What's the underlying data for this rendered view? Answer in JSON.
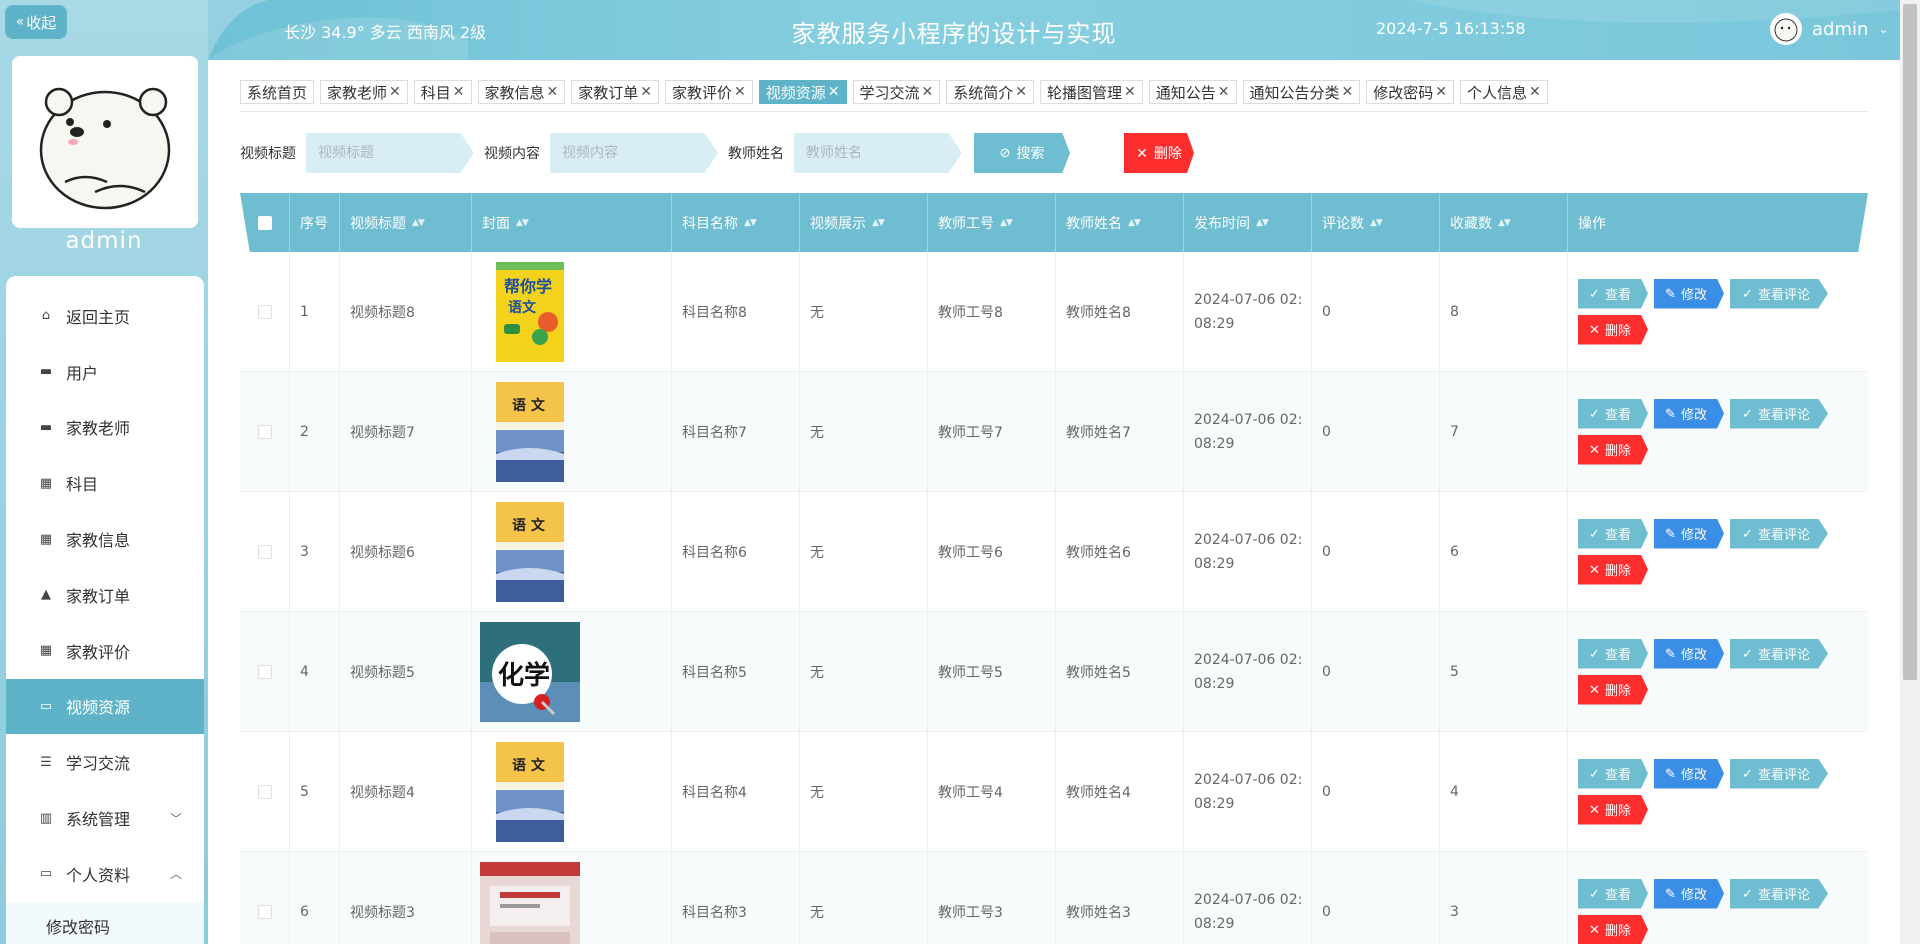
{
  "sidebar": {
    "collapse_label": "收起",
    "username": "admin",
    "menu": [
      {
        "label": "返回主页",
        "icon": "home-icon"
      },
      {
        "label": "用户",
        "icon": "user-icon"
      },
      {
        "label": "家教老师",
        "icon": "teacher-icon"
      },
      {
        "label": "科目",
        "icon": "grid-icon"
      },
      {
        "label": "家教信息",
        "icon": "grid-icon"
      },
      {
        "label": "家教订单",
        "icon": "person-icon"
      },
      {
        "label": "家教评价",
        "icon": "grid-icon"
      },
      {
        "label": "视频资源",
        "icon": "monitor-icon",
        "active": true
      },
      {
        "label": "学习交流",
        "icon": "list-icon"
      },
      {
        "label": "系统管理",
        "icon": "chart-icon",
        "chevron": "down"
      },
      {
        "label": "个人资料",
        "icon": "card-icon",
        "chevron": "up"
      }
    ],
    "submenu": [
      {
        "label": "修改密码"
      }
    ]
  },
  "header": {
    "weather": "长沙  34.9°  多云  西南风  2级",
    "title": "家教服务小程序的设计与实现",
    "datetime": "2024-7-5 16:13:58",
    "username": "admin"
  },
  "tabs": [
    {
      "label": "系统首页",
      "closable": false
    },
    {
      "label": "家教老师",
      "closable": true
    },
    {
      "label": "科目",
      "closable": true
    },
    {
      "label": "家教信息",
      "closable": true
    },
    {
      "label": "家教订单",
      "closable": true
    },
    {
      "label": "家教评价",
      "closable": true
    },
    {
      "label": "视频资源",
      "closable": true,
      "active": true
    },
    {
      "label": "学习交流",
      "closable": true
    },
    {
      "label": "系统简介",
      "closable": true
    },
    {
      "label": "轮播图管理",
      "closable": true
    },
    {
      "label": "通知公告",
      "closable": true
    },
    {
      "label": "通知公告分类",
      "closable": true
    },
    {
      "label": "修改密码",
      "closable": true
    },
    {
      "label": "个人信息",
      "closable": true
    }
  ],
  "search": {
    "title_label": "视频标题",
    "title_placeholder": "视频标题",
    "content_label": "视频内容",
    "content_placeholder": "视频内容",
    "teacher_label": "教师姓名",
    "teacher_placeholder": "教师姓名",
    "search_button": "搜索",
    "delete_button": "删除"
  },
  "table": {
    "columns": [
      "",
      "序号",
      "视频标题",
      "封面",
      "科目名称",
      "视频展示",
      "教师工号",
      "教师姓名",
      "发布时间",
      "评论数",
      "收藏数",
      "操作"
    ],
    "actions": {
      "view": "查看",
      "edit": "修改",
      "comment": "查看评论",
      "delete": "删除"
    },
    "rows": [
      {
        "index": "1",
        "title": "视频标题8",
        "cover": "yellow-book",
        "subject": "科目名称8",
        "show": "无",
        "tno": "教师工号8",
        "tname": "教师姓名8",
        "time": "2024-07-06 02:\n08:29",
        "comments": "0",
        "favorites": "8"
      },
      {
        "index": "2",
        "title": "视频标题7",
        "cover": "yuwen-book",
        "subject": "科目名称7",
        "show": "无",
        "tno": "教师工号7",
        "tname": "教师姓名7",
        "time": "2024-07-06 02:\n08:29",
        "comments": "0",
        "favorites": "7"
      },
      {
        "index": "3",
        "title": "视频标题6",
        "cover": "yuwen-book",
        "subject": "科目名称6",
        "show": "无",
        "tno": "教师工号6",
        "tname": "教师姓名6",
        "time": "2024-07-06 02:\n08:29",
        "comments": "0",
        "favorites": "6"
      },
      {
        "index": "4",
        "title": "视频标题5",
        "cover": "chemistry-book",
        "subject": "科目名称5",
        "show": "无",
        "tno": "教师工号5",
        "tname": "教师姓名5",
        "time": "2024-07-06 02:\n08:29",
        "comments": "0",
        "favorites": "5"
      },
      {
        "index": "5",
        "title": "视频标题4",
        "cover": "yuwen-book",
        "subject": "科目名称4",
        "show": "无",
        "tno": "教师工号4",
        "tname": "教师姓名4",
        "time": "2024-07-06 02:\n08:29",
        "comments": "0",
        "favorites": "4"
      },
      {
        "index": "6",
        "title": "视频标题3",
        "cover": "english-book",
        "subject": "科目名称3",
        "show": "无",
        "tno": "教师工号3",
        "tname": "教师姓名3",
        "time": "2024-07-06 02:\n08:29",
        "comments": "0",
        "favorites": "3"
      }
    ]
  },
  "colors": {
    "accent": "#5fb3c9",
    "header_bg": "#6fbdd1",
    "edit_blue": "#3a8ee6",
    "danger_red": "#ff2e2e"
  }
}
